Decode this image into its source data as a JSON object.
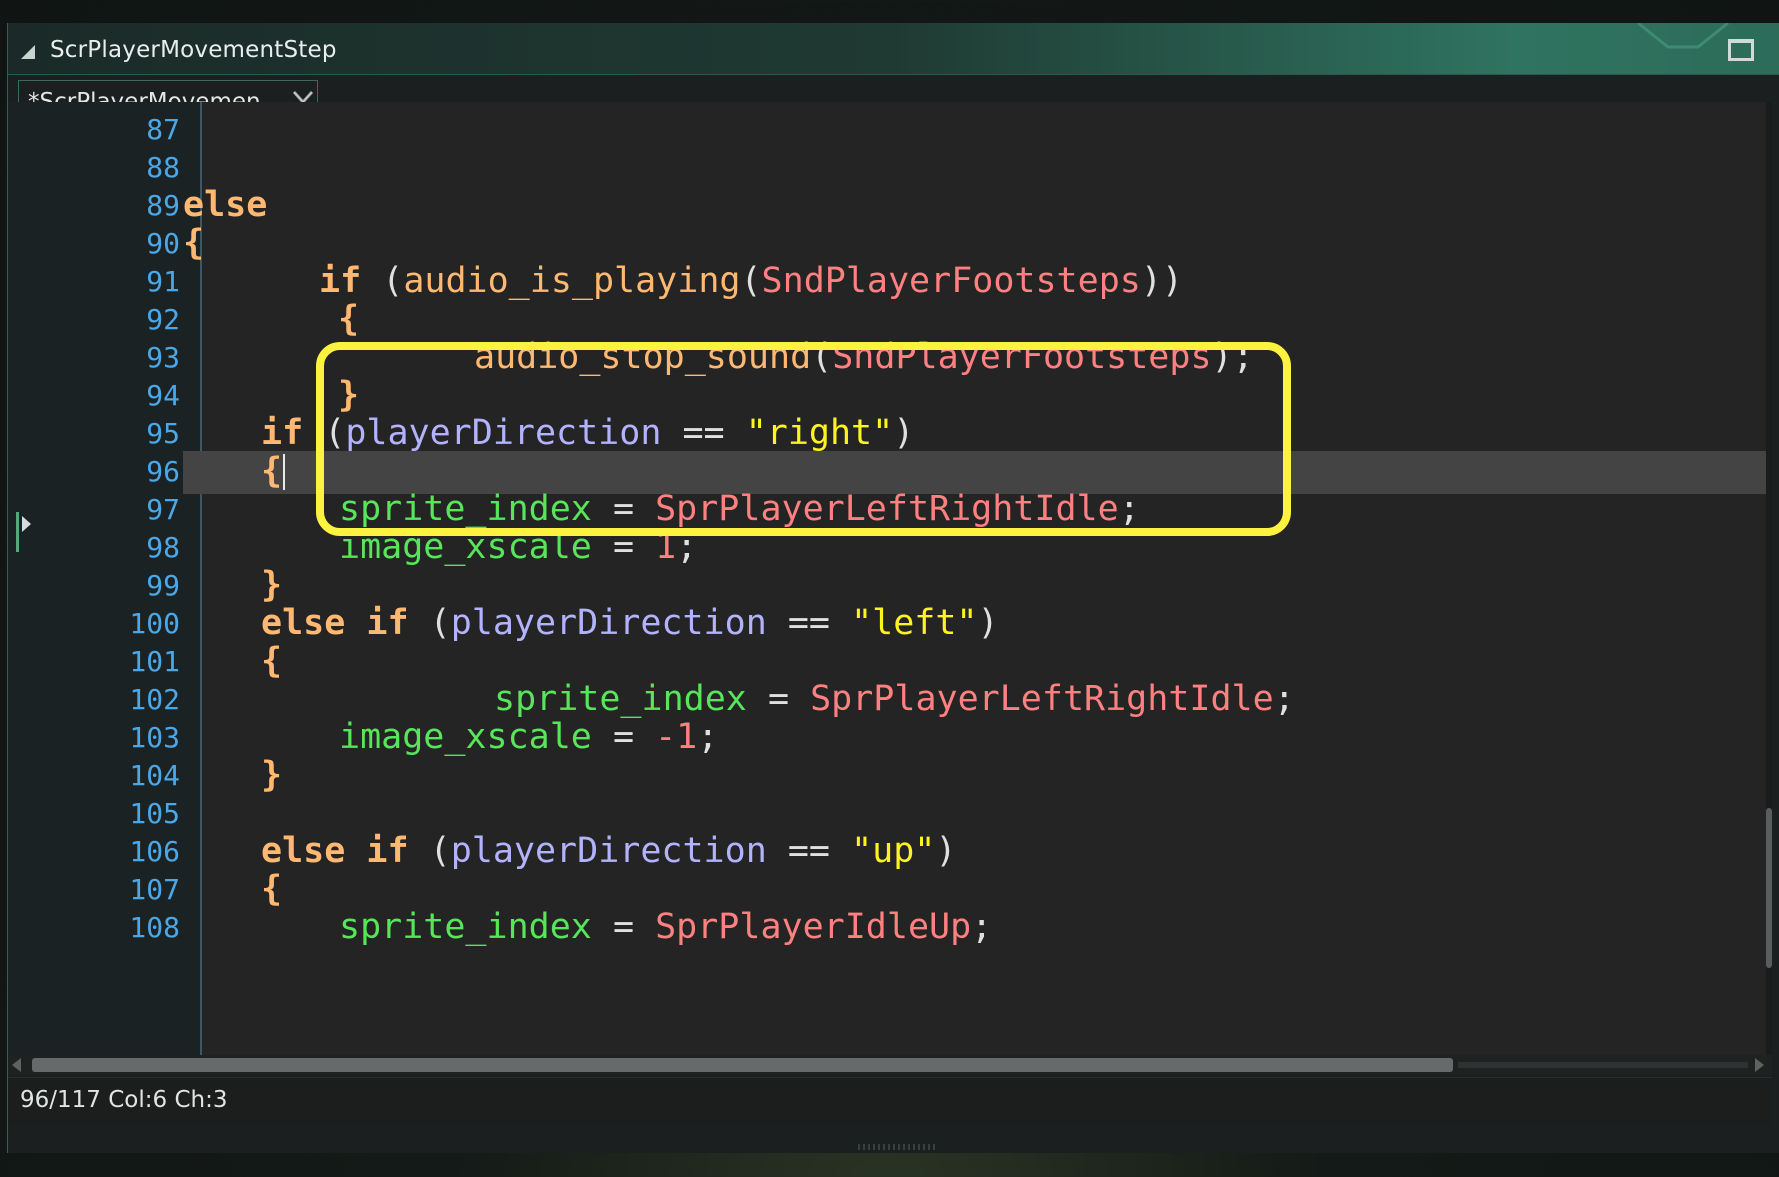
{
  "window": {
    "title": "ScrPlayerMovementStep",
    "tab_label": "*ScrPlayerMovemen...",
    "icons": {
      "title": "triangle-corner-icon",
      "maximize": "maximize-icon",
      "tab_close": "close-icon"
    }
  },
  "editor": {
    "current_line": "96",
    "lines": [
      {
        "n": "87"
      },
      {
        "n": "88"
      },
      {
        "n": "89",
        "kw1": "else"
      },
      {
        "n": "90",
        "p1": "{"
      },
      {
        "n": "91",
        "kw1": "if",
        "p1": " (",
        "fn": "audio_is_playing",
        "p2": "(",
        "res": "SndPlayerFootsteps",
        "p3": "))"
      },
      {
        "n": "92",
        "p1": "{"
      },
      {
        "n": "93",
        "fn": "audio_stop_sound",
        "p1": "(",
        "res": "SndPlayerFootsteps",
        "p2": ");"
      },
      {
        "n": "94",
        "p1": "}"
      },
      {
        "n": "95",
        "kw1": "if",
        "p1": " (",
        "var": "playerDirection",
        "op": " == ",
        "str": "\"right\"",
        "p2": ")"
      },
      {
        "n": "96",
        "p1": "{"
      },
      {
        "n": "97",
        "bi": "sprite_index",
        "op": " = ",
        "res": "SprPlayerLeftRightIdle",
        "p1": ";"
      },
      {
        "n": "98",
        "bi": "image_xscale",
        "op": " = ",
        "num": "1",
        "p1": ";"
      },
      {
        "n": "99",
        "p1": "}"
      },
      {
        "n": "100",
        "kw1": "else",
        "kw2": "if",
        "p1": " (",
        "var": "playerDirection",
        "op": " == ",
        "str": "\"left\"",
        "p2": ")"
      },
      {
        "n": "101",
        "p1": "{"
      },
      {
        "n": "102",
        "bi": "sprite_index",
        "op": " = ",
        "res": "SprPlayerLeftRightIdle",
        "p1": ";"
      },
      {
        "n": "103",
        "bi": "image_xscale",
        "op": " = ",
        "num": "-1",
        "p1": ";"
      },
      {
        "n": "104",
        "p1": "}"
      },
      {
        "n": "105"
      },
      {
        "n": "106",
        "kw1": "else",
        "kw2": "if",
        "p1": " (",
        "var": "playerDirection",
        "op": " == ",
        "str": "\"up\"",
        "p2": ")"
      },
      {
        "n": "107",
        "p1": "{"
      },
      {
        "n": "108",
        "bi": "sprite_index",
        "op": " = ",
        "res": "SprPlayerIdleUp",
        "p1": ";"
      }
    ]
  },
  "status": {
    "text": "96/117 Col:6 Ch:3"
  },
  "colors": {
    "keyword": "#ffb871",
    "resource": "#ff8080",
    "variable": "#b2b2ff",
    "builtin": "#58e55a",
    "string": "#fcf320",
    "line_number": "#4aa7e8",
    "highlight_box": "#fdf23f"
  }
}
